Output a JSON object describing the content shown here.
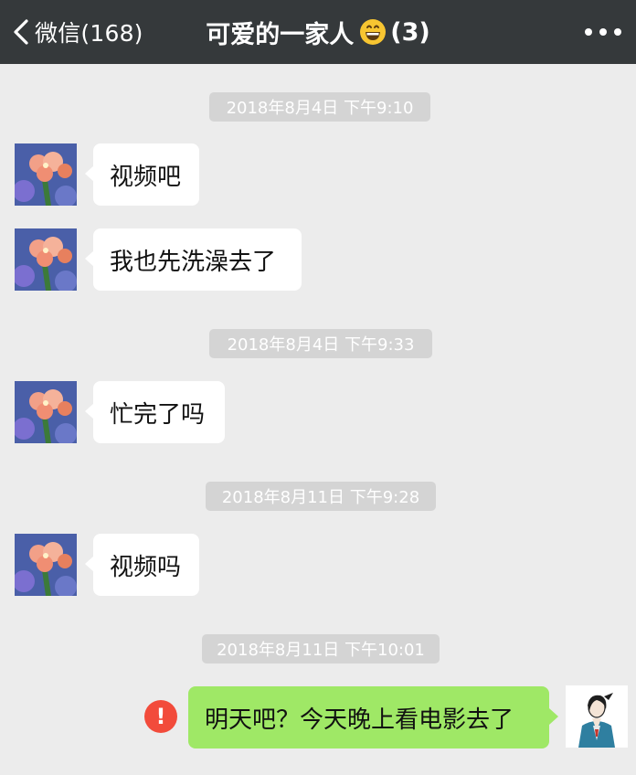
{
  "header": {
    "back_label": "微信(168)",
    "title": "可爱的一家人",
    "member_count": "(3)",
    "back_icon": "chevron-left-icon",
    "emoji_icon": "grinning-face-icon",
    "more_icon": "more-dots-icon"
  },
  "messages": [
    {
      "time": "2018年8月4日 下午9:10"
    },
    {
      "side": "in",
      "text": "视频吧"
    },
    {
      "side": "in",
      "text": "我也先洗澡去了"
    },
    {
      "time": "2018年8月4日 下午9:33"
    },
    {
      "side": "in",
      "text": "忙完了吗"
    },
    {
      "time": "2018年8月11日 下午9:28"
    },
    {
      "side": "in",
      "text": "视频吗"
    },
    {
      "time": "2018年8月11日 下午10:01"
    },
    {
      "side": "out",
      "text": "明天吧？今天晚上看电影去了",
      "status_text": "!"
    }
  ],
  "colors": {
    "background": "#ececec",
    "topbar": "#35393b",
    "bubble_in": "#ffffff",
    "bubble_out": "#9fe866",
    "failed_badge": "#f24b3b"
  }
}
